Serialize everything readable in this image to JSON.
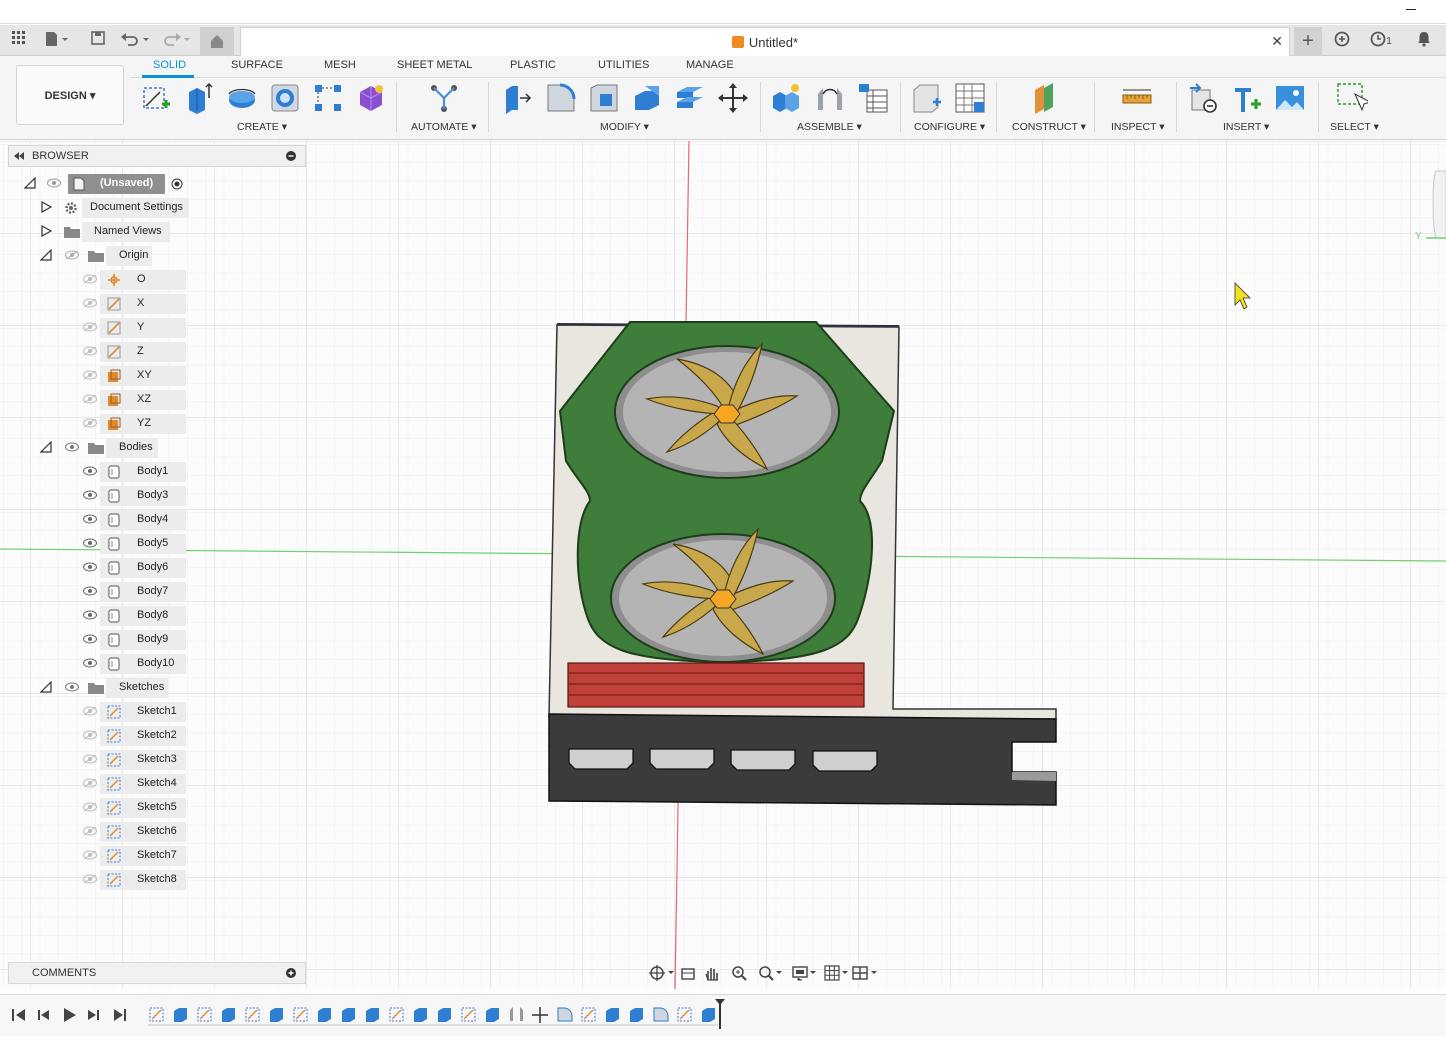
{
  "app": {
    "document_title": "Untitled*",
    "job_count": "1"
  },
  "toolbar": {
    "workspace_button": "DESIGN",
    "tabs": [
      "SOLID",
      "SURFACE",
      "MESH",
      "SHEET METAL",
      "PLASTIC",
      "UTILITIES",
      "MANAGE"
    ],
    "active_tab": "SOLID",
    "groups": [
      "CREATE",
      "AUTOMATE",
      "MODIFY",
      "ASSEMBLE",
      "CONFIGURE",
      "CONSTRUCT",
      "INSPECT",
      "INSERT",
      "SELECT"
    ]
  },
  "browser": {
    "title": "BROWSER",
    "root": "(Unsaved)",
    "document_settings": "Document Settings",
    "named_views": "Named Views",
    "origin": {
      "label": "Origin",
      "items": [
        "O",
        "X",
        "Y",
        "Z",
        "XY",
        "XZ",
        "YZ"
      ]
    },
    "bodies": {
      "label": "Bodies",
      "items": [
        "Body1",
        "Body3",
        "Body4",
        "Body5",
        "Body6",
        "Body7",
        "Body8",
        "Body9",
        "Body10"
      ]
    },
    "sketches": {
      "label": "Sketches",
      "items": [
        "Sketch1",
        "Sketch2",
        "Sketch3",
        "Sketch4",
        "Sketch5",
        "Sketch6",
        "Sketch7",
        "Sketch8"
      ]
    }
  },
  "comments": {
    "title": "COMMENTS"
  },
  "viewcube": {
    "axis_label": "Y"
  },
  "colors": {
    "accent": "#0696d7",
    "shroud_green": "#3f7d3a",
    "fan_blade": "#c8a84a",
    "heatsink_red": "#c0413a",
    "bracket_dark": "#3b3b3b",
    "pcb_light": "#e9e6df",
    "axis_red": "#e04040",
    "axis_green": "#40c040"
  }
}
